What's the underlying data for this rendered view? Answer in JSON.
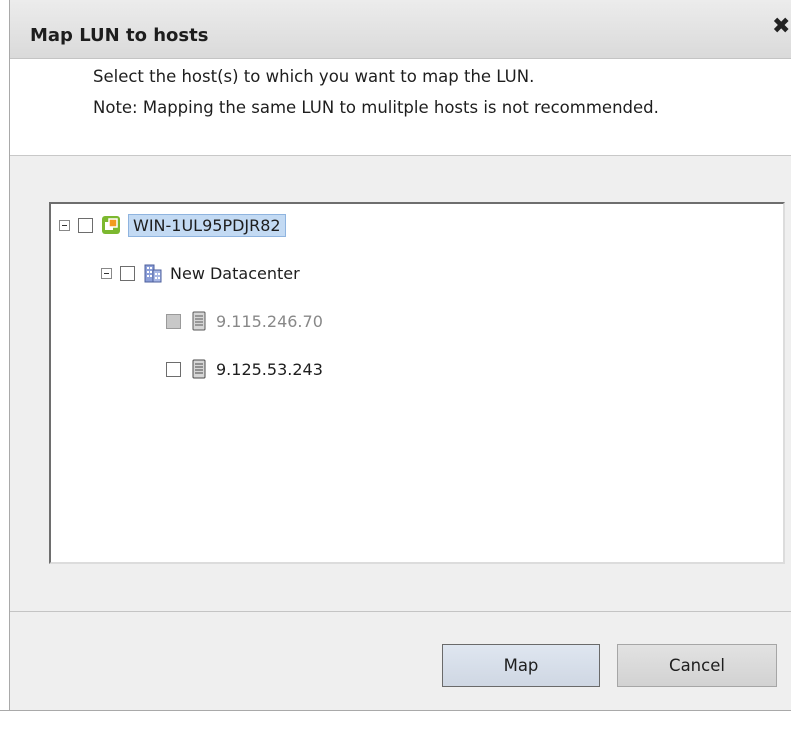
{
  "dialog": {
    "title": "Map LUN to hosts",
    "close_icon": "close-icon",
    "intro_line1": "Select the host(s) to which you want to map the LUN.",
    "intro_line2": "Note: Mapping the same LUN to mulitple hosts is not recommended."
  },
  "tree": {
    "nodes": [
      {
        "label": "WIN-1UL95PDJR82",
        "icon": "vcenter-icon",
        "expanded": true,
        "checked": false,
        "selected": true,
        "disabled": false
      },
      {
        "label": "New Datacenter",
        "icon": "datacenter-icon",
        "expanded": true,
        "checked": false,
        "selected": false,
        "disabled": false
      },
      {
        "label": "9.115.246.70",
        "icon": "server-icon",
        "checked": false,
        "selected": false,
        "disabled": true
      },
      {
        "label": "9.125.53.243",
        "icon": "server-icon",
        "checked": false,
        "selected": false,
        "disabled": false
      }
    ]
  },
  "buttons": {
    "map_label": "Map",
    "cancel_label": "Cancel"
  },
  "colors": {
    "selection_bg": "#c3daf3",
    "vcenter_green": "#7cb82f",
    "vcenter_orange": "#f29b21"
  }
}
